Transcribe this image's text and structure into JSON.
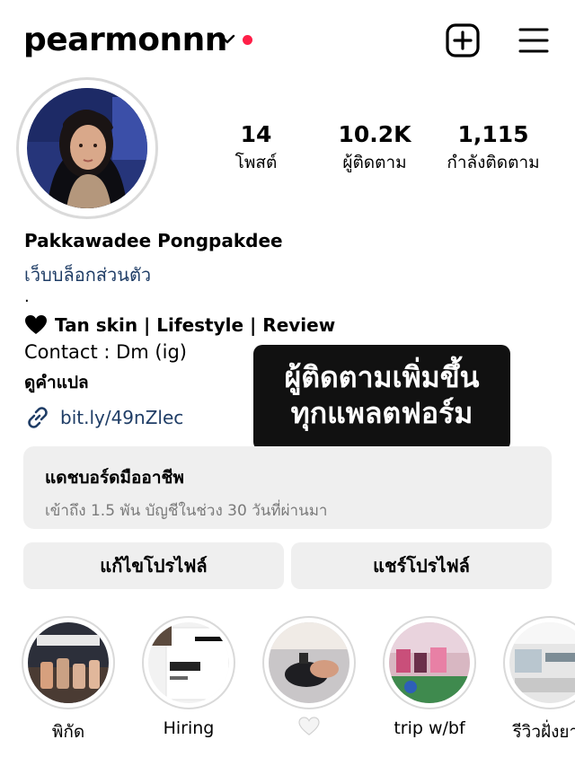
{
  "header": {
    "username": "pearmonnn",
    "icons": {
      "dropdown": "chevron-down-icon",
      "notification": "red-dot",
      "create": "plus-square-icon",
      "menu": "hamburger-menu-icon"
    },
    "notification_color": "#ff1f48"
  },
  "stats": [
    {
      "value": "14",
      "label": "โพสต์"
    },
    {
      "value": "10.2K",
      "label": "ผู้ติดตาม"
    },
    {
      "value": "1,115",
      "label": "กำลังติดตาม"
    }
  ],
  "bio": {
    "name": "Pakkawadee Pongpakdee",
    "category": "เว็บบล็อกส่วนตัว",
    "dot": ".",
    "tagline": "Tan skin | Lifestyle | Review",
    "contact": "Contact : Dm (ig)",
    "translate": "ดูคำแปล",
    "link": "bit.ly/49nZlec",
    "link_color": "#1f3d66"
  },
  "caption": {
    "line1": "ผู้ติดตามเพิ่มขึ้น",
    "line2": "ทุกแพลตฟอร์ม"
  },
  "dashboard": {
    "title": "แดชบอร์ดมืออาชีพ",
    "subtitle": "เข้าถึง 1.5 พัน บัญชีในช่วง 30 วันที่ผ่านมา"
  },
  "buttons": {
    "edit": "แก้ไขโปรไฟล์",
    "share": "แชร์โปรไฟล์"
  },
  "highlights": [
    {
      "label": "พิกัด"
    },
    {
      "label": "Hiring"
    },
    {
      "label": ""
    },
    {
      "label": "trip w/bf"
    },
    {
      "label": "รีวิวฝั่งยาง"
    }
  ]
}
